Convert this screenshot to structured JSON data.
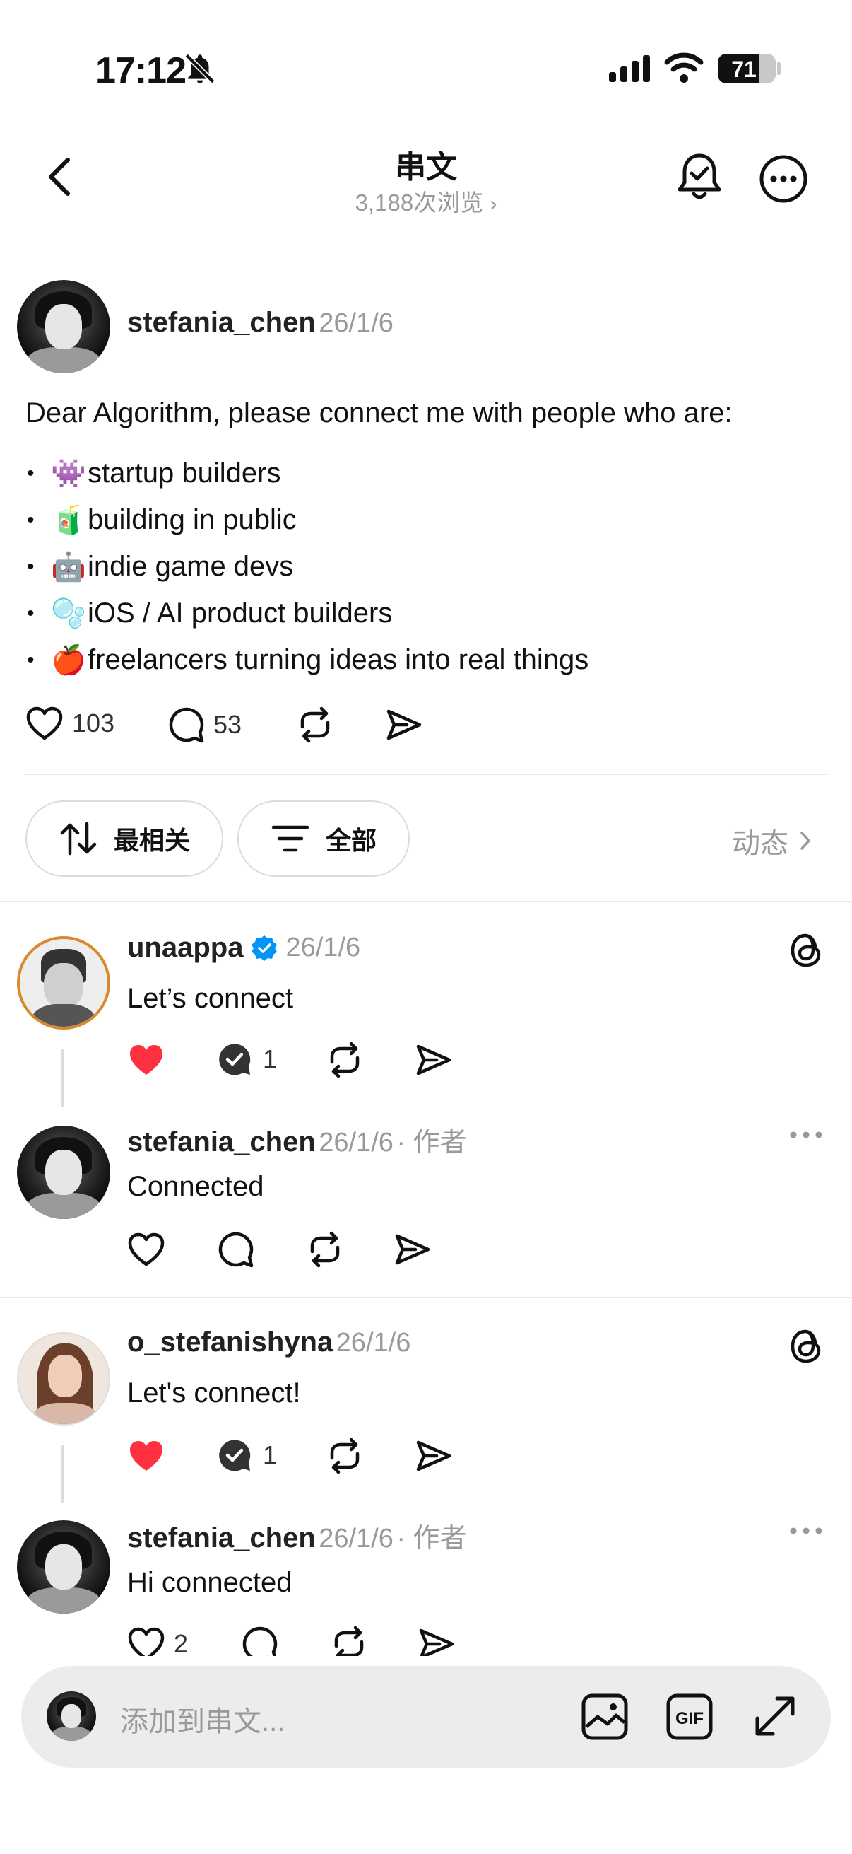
{
  "status_bar": {
    "time": "17:12",
    "battery": "71",
    "battery_level": 0.71
  },
  "header": {
    "title": "串文",
    "views": "3,188次浏览"
  },
  "post": {
    "author": "stefania_chen",
    "date": "26/1/6",
    "text": "Dear Algorithm, please connect me with people who are:",
    "bullets": [
      {
        "emoji": "👾",
        "text": "startup builders"
      },
      {
        "emoji": "🧃",
        "text": "building in public"
      },
      {
        "emoji": "🤖",
        "text": "indie game devs"
      },
      {
        "emoji": "🫧",
        "text": "iOS / AI product builders"
      },
      {
        "emoji": "🍎",
        "text": "freelancers turning ideas into real things"
      }
    ],
    "likes": "103",
    "comments": "53"
  },
  "filters": {
    "sort_label": "最相关",
    "filter_label": "全部",
    "activity_label": "动态"
  },
  "replies": [
    {
      "author": "unaappa",
      "date": "26/1/6",
      "text": "Let’s connect",
      "liked": true,
      "comment_count": "1"
    },
    {
      "author": "stefania_chen",
      "date": "26/1/6",
      "tag": "· 作者",
      "text": "Connected"
    },
    {
      "author": "o_stefanishyna",
      "date": "26/1/6",
      "text": "Let's connect!",
      "liked": true,
      "comment_count": "1"
    },
    {
      "author": "stefania_chen",
      "date": "26/1/6",
      "tag": "· 作者",
      "text": "Hi connected",
      "like_count": "2"
    }
  ],
  "composer": {
    "placeholder": "添加到串文..."
  },
  "colors": {
    "like_red": "#ff3040",
    "verified_blue": "#0095f6",
    "muted": "#999999"
  },
  "icons": [
    "bell-slash-icon",
    "signal-icon",
    "wifi-icon",
    "back-icon",
    "notification-bell-icon",
    "more-icon",
    "heart-icon",
    "comment-icon",
    "repost-icon",
    "share-icon",
    "sort-icon",
    "filter-icon",
    "chevron-right-icon",
    "threads-icon",
    "verified-badge-icon",
    "image-icon",
    "gif-icon",
    "expand-icon"
  ]
}
